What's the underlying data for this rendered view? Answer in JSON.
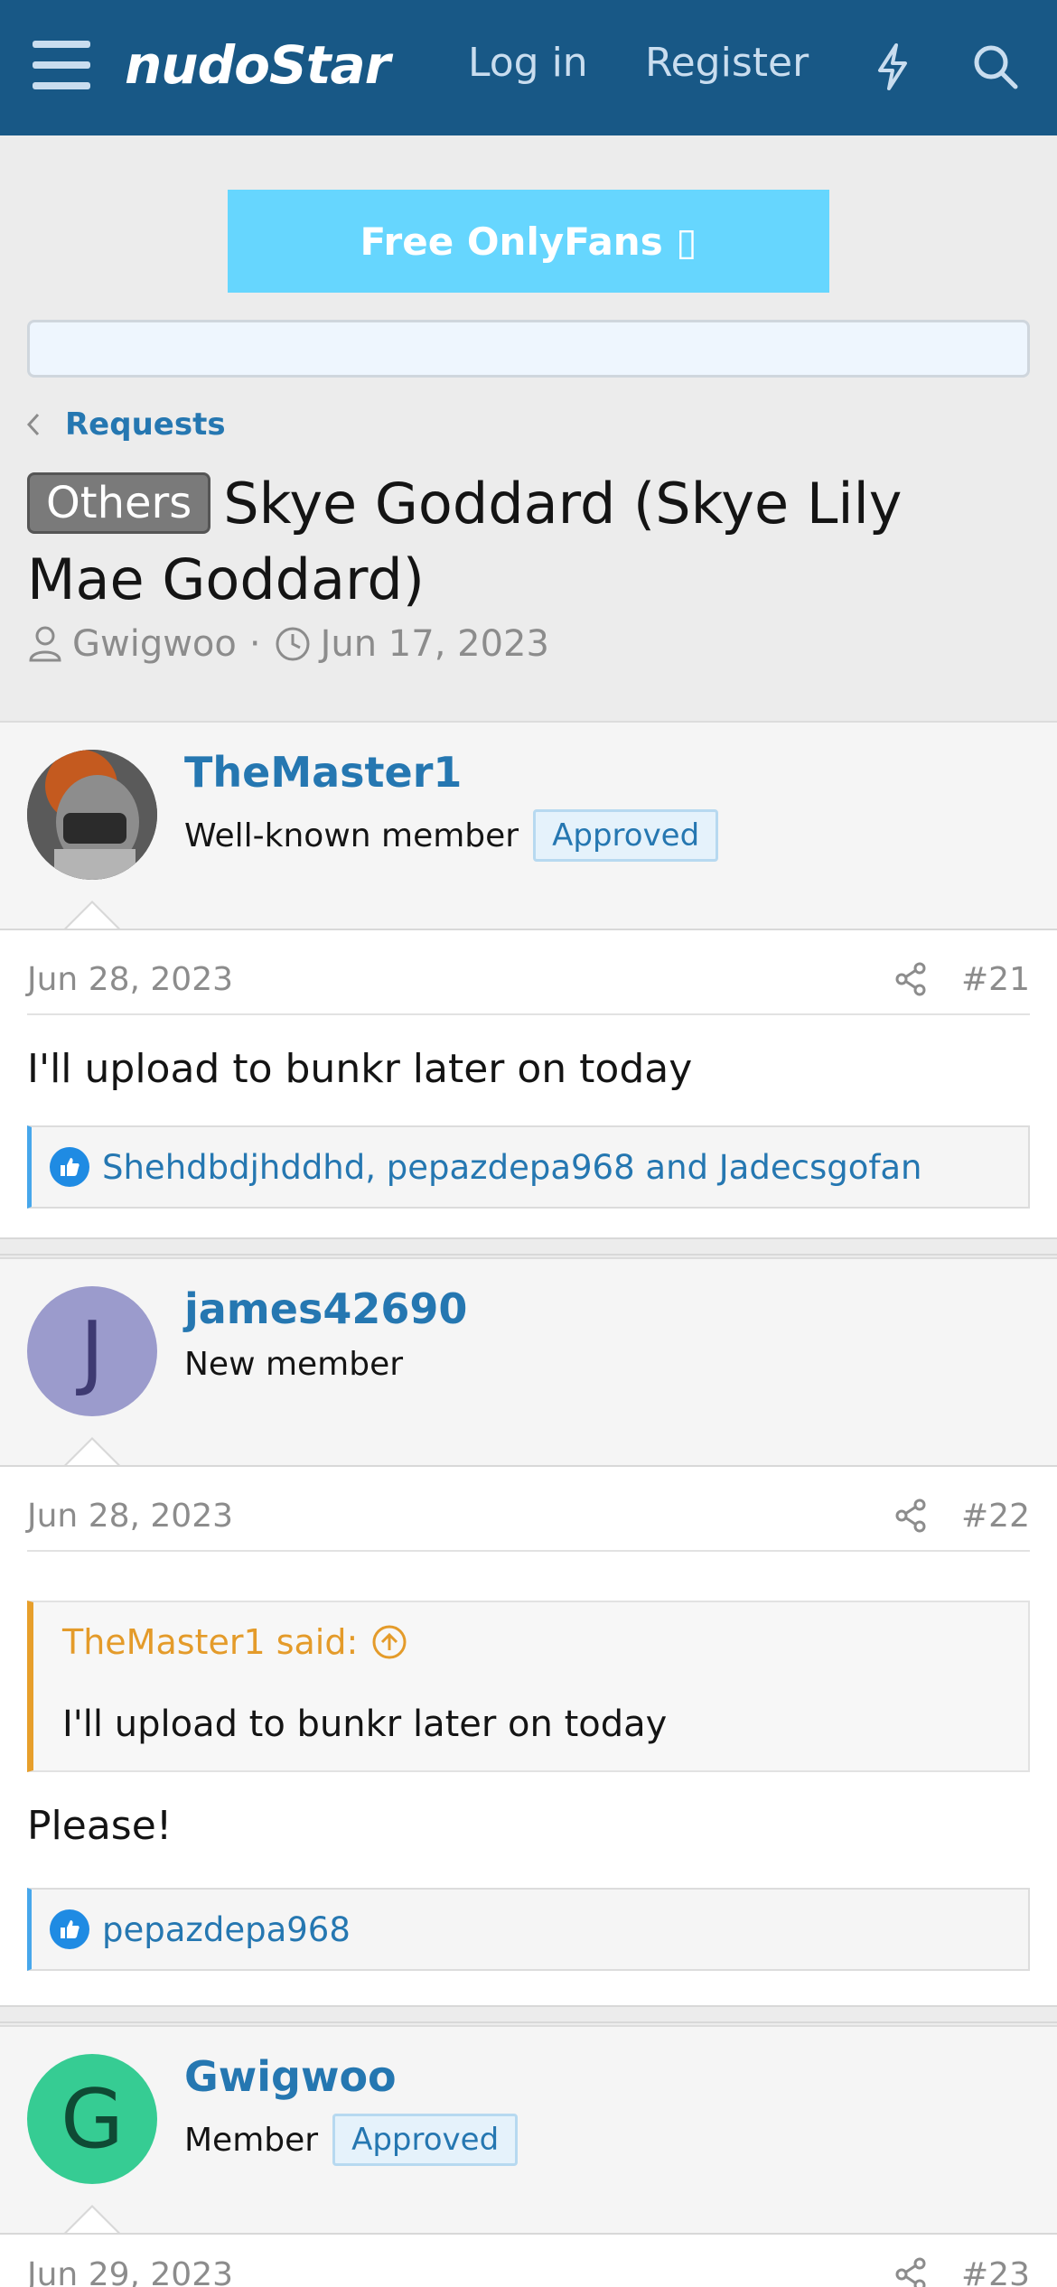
{
  "header": {
    "brand": "nudoStar",
    "login": "Log in",
    "register": "Register"
  },
  "promo": {
    "label": "Free OnlyFans ▯"
  },
  "breadcrumb": {
    "label": "Requests"
  },
  "thread": {
    "prefix": "Others",
    "title": "Skye Goddard (Skye Lily Mae Goddard)",
    "author": "Gwigwoo",
    "date": "Jun 17, 2023"
  },
  "posts": [
    {
      "username": "TheMaster1",
      "user_title": "Well-known member",
      "badge": "Approved",
      "date": "Jun 28, 2023",
      "number": "#21",
      "text": "I'll upload to bunkr later on today",
      "reactions": "Shehdbdjhddhd, pepazdepa968 and Jadecsgofan"
    },
    {
      "username": "james42690",
      "avatar_letter": "J",
      "user_title": "New member",
      "date": "Jun 28, 2023",
      "number": "#22",
      "quote_author": "TheMaster1 said:",
      "quote_text": "I'll upload to bunkr later on today",
      "text": "Please!",
      "reactions": "pepazdepa968"
    },
    {
      "username": "Gwigwoo",
      "avatar_letter": "G",
      "user_title": "Member",
      "badge": "Approved",
      "date": "Jun 29, 2023",
      "number": "#23"
    }
  ],
  "colors": {
    "header_bg": "#185886",
    "link": "#2577b1",
    "promo_bg": "#66d6fe",
    "quote_accent": "#e79f2b",
    "avatar_j": "#9b9bcc",
    "avatar_g": "#36cc93"
  }
}
